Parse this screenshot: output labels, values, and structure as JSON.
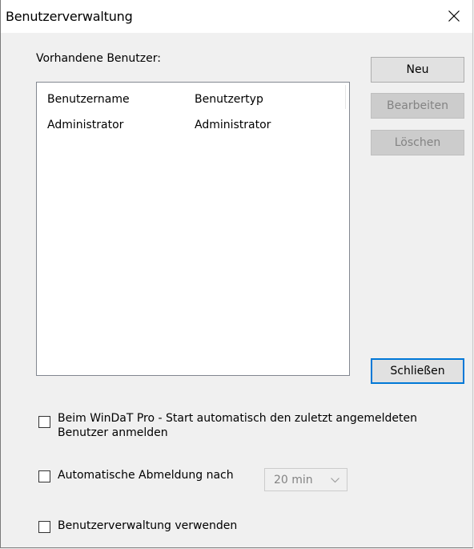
{
  "window": {
    "title": "Benutzerverwaltung",
    "close_icon": "close-icon"
  },
  "users": {
    "label": "Vorhandene Benutzer:",
    "columns": [
      "Benutzername",
      "Benutzertyp"
    ],
    "rows": [
      {
        "name": "Administrator",
        "type": "Administrator"
      }
    ]
  },
  "buttons": {
    "new": "Neu",
    "edit": "Bearbeiten",
    "delete": "Löschen",
    "close": "Schließen"
  },
  "options": {
    "auto_login": {
      "label": "Beim WinDaT Pro - Start automatisch den zuletzt angemeldeten Benutzer anmelden",
      "checked": false
    },
    "auto_logout": {
      "label": "Automatische Abmeldung nach",
      "checked": false,
      "select_value": "20 min"
    },
    "use_user_management": {
      "label": "Benutzerverwaltung verwenden",
      "checked": false
    }
  }
}
